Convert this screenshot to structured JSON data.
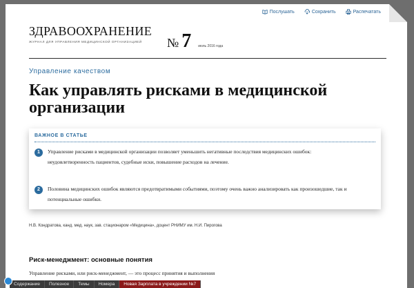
{
  "toolbar": {
    "listen": "Послушать",
    "save": "Сохранить",
    "print": "Распечатать"
  },
  "masthead": {
    "logo": "ЗДРАВООХРАНЕНИЕ",
    "subtitle": "ЖУРНАЛ ДЛЯ УПРАВЛЕНИЯ МЕДИЦИНСКОЙ ОРГАНИЗАЦИЕЙ",
    "issue_prefix": "№",
    "issue_number": "7",
    "issue_date": "июль 2016 года"
  },
  "article": {
    "rubric": "Управление качеством",
    "title": "Как управлять рисками в медицинской организации",
    "highlights_title": "ВАЖНОЕ В СТАТЬЕ",
    "highlights": [
      {
        "num": "1",
        "text": "Управление рисками в медицинской организации позволяет уменьшить негативные последствия медицинских ошибок: неудовлетворенность пациентов, судебные иски, повышение расходов на лечение."
      },
      {
        "num": "2",
        "text": "Половина медицинских ошибок являются предотвратимыми событиями, поэтому очень важно анализировать как произошедшие, так и потенциальные ошибки."
      }
    ],
    "author": "Н.В. Кондратова, канд. мед. наук, зав. стационаром «Медицина», доцент РНИМУ им. Н.И. Пирогова",
    "section_heading": "Риск-менеджмент: основные понятия",
    "paragraph": "Управление рисками, или риск-менеджмент, — это процесс принятия и выполнения"
  },
  "bottom_tabs": [
    "Содержание",
    "Полезное",
    "Темы",
    "Номера",
    "Новая Зарплата в учреждении №7"
  ]
}
